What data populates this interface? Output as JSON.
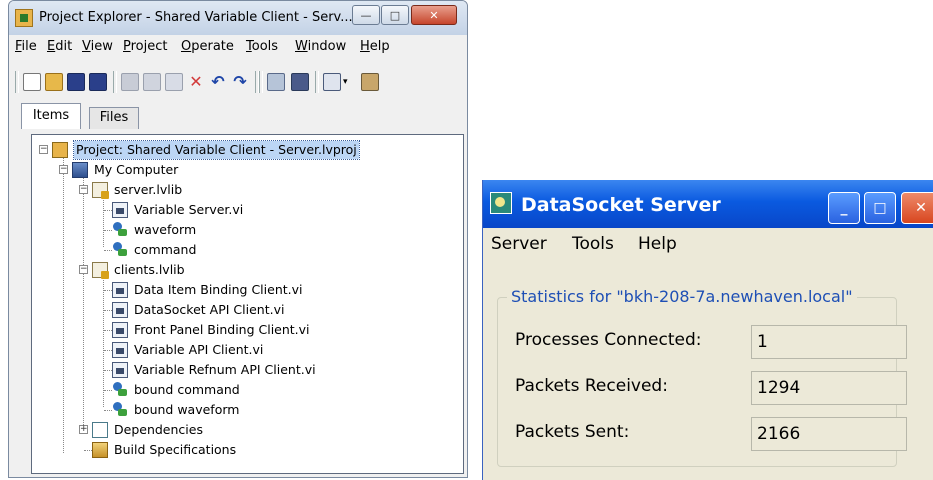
{
  "project_explorer": {
    "title": "Project Explorer - Shared Variable Client - Serv...",
    "caption_buttons": {
      "minimize": "—",
      "maximize": "□",
      "close": "✕"
    },
    "menu": [
      "File",
      "Edit",
      "View",
      "Project",
      "Operate",
      "Tools",
      "Window",
      "Help"
    ],
    "toolbar_icons": [
      "new-icon",
      "open-icon",
      "save-icon",
      "save-all-icon",
      "cut-icon",
      "copy-icon",
      "paste-icon",
      "delete-icon",
      "undo-icon",
      "redo-icon",
      "resolve-conflicts-icon",
      "build-icon",
      "view-icon",
      "additional-tools-icon"
    ],
    "tabs": {
      "items": "Items",
      "files": "Files"
    },
    "tree": {
      "project": "Project: Shared Variable Client - Server.lvproj",
      "my_computer": "My Computer",
      "server_lib": "server.lvlib",
      "server_items": [
        "Variable Server.vi",
        "waveform",
        "command"
      ],
      "clients_lib": "clients.lvlib",
      "clients_items": [
        "Data Item Binding Client.vi",
        "DataSocket API Client.vi",
        "Front Panel Binding Client.vi",
        "Variable API Client.vi",
        "Variable Refnum API Client.vi",
        "bound command",
        "bound waveform"
      ],
      "dependencies": "Dependencies",
      "build_specs": "Build Specifications"
    }
  },
  "datasocket": {
    "title": "DataSocket Server",
    "caption_buttons": {
      "minimize": "_",
      "maximize": "□",
      "close": "✕"
    },
    "menu": [
      "Server",
      "Tools",
      "Help"
    ],
    "group_label": "Statistics for \"bkh-208-7a.newhaven.local\"",
    "stats": [
      {
        "label": "Processes Connected:",
        "value": "1"
      },
      {
        "label": "Packets Received:",
        "value": "1294"
      },
      {
        "label": "Packets Sent:",
        "value": "2166"
      }
    ]
  }
}
